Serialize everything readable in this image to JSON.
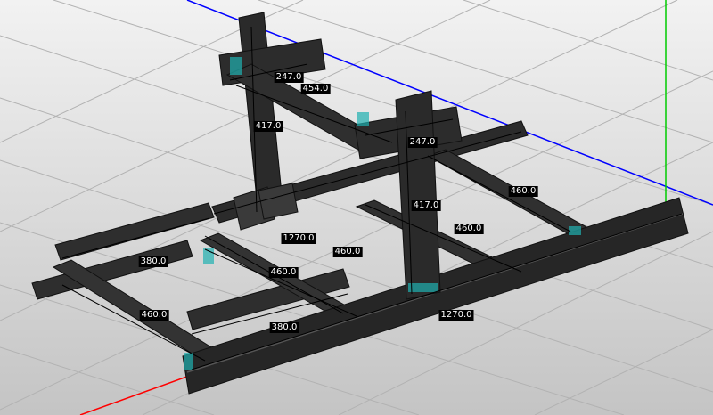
{
  "viewport": {
    "background_top": "#f2f2f2",
    "background_bottom": "#c4c4c4",
    "grid_color": "#b2b2b2",
    "axes": {
      "x": "#ff0000",
      "y": "#00cc00",
      "z": "#0000ff"
    },
    "frame_color": "#2b2b2b",
    "highlight_color": "#20b0b0"
  },
  "dimensions": [
    {
      "id": "top-beam-width",
      "text": "247.0"
    },
    {
      "id": "top-beam-length",
      "text": "454.0"
    },
    {
      "id": "left-upright-height",
      "text": "417.0"
    },
    {
      "id": "right-beam-width",
      "text": "247.0"
    },
    {
      "id": "right-depth",
      "text": "460.0"
    },
    {
      "id": "right-upright-height",
      "text": "417.0"
    },
    {
      "id": "mid-depth",
      "text": "460.0"
    },
    {
      "id": "back-rail-length",
      "text": "1270.0"
    },
    {
      "id": "center-width",
      "text": "460.0"
    },
    {
      "id": "left-width",
      "text": "380.0"
    },
    {
      "id": "left-center-depth",
      "text": "460.0"
    },
    {
      "id": "front-left-depth",
      "text": "460.0"
    },
    {
      "id": "front-width",
      "text": "380.0"
    },
    {
      "id": "front-rail-length",
      "text": "1270.0"
    }
  ]
}
